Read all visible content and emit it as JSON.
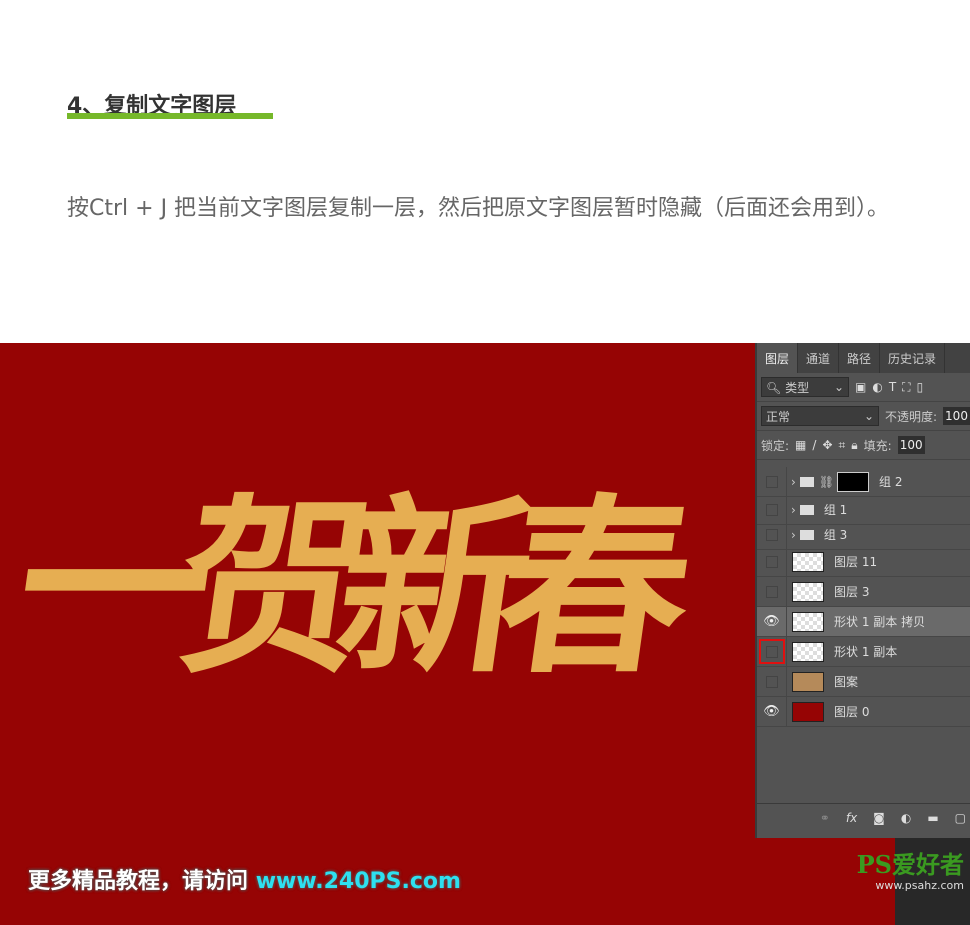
{
  "article": {
    "heading": "4、复制文字图层",
    "accent": "#76b82a",
    "paragraph": "按Ctrl + J 把当前文字图层复制一层，然后把原文字图层暂时隐藏（后面还会用到）。"
  },
  "artwork": {
    "lettering": "一贺新春",
    "background": "#960404",
    "text_color": "#e6ae52",
    "promo_text": "更多精品教程，请访问",
    "promo_url": "www.240PS.com",
    "watermark": "PS爱好者",
    "watermark_url": "www.psahz.com"
  },
  "panel": {
    "tabs": [
      "图层",
      "通道",
      "路径",
      "历史记录"
    ],
    "filter_label": "类型",
    "blend_mode": "正常",
    "opacity_label": "不透明度:",
    "opacity_value": "100",
    "lock_label": "锁定:",
    "fill_label": "填充:",
    "fill_value": "100",
    "layers": [
      {
        "name": "组 2",
        "type": "group",
        "visible": false
      },
      {
        "name": "组 1",
        "type": "group",
        "visible": false
      },
      {
        "name": "组 3",
        "type": "group",
        "visible": false
      },
      {
        "name": "图层 11",
        "type": "layer",
        "visible": false
      },
      {
        "name": "图层 3",
        "type": "layer",
        "visible": false
      },
      {
        "name": "形状 1 副本 拷贝",
        "type": "smart",
        "visible": true,
        "selected": true
      },
      {
        "name": "形状 1 副本",
        "type": "smart",
        "visible": false,
        "highlighted_box": true
      },
      {
        "name": "图案",
        "type": "layer",
        "visible": false
      },
      {
        "name": "图层 0",
        "type": "layer",
        "visible": true
      }
    ],
    "footer_icons": [
      "link-icon",
      "fx-icon",
      "mask-icon",
      "adjustment-icon",
      "folder-icon",
      "new-layer-icon"
    ]
  }
}
